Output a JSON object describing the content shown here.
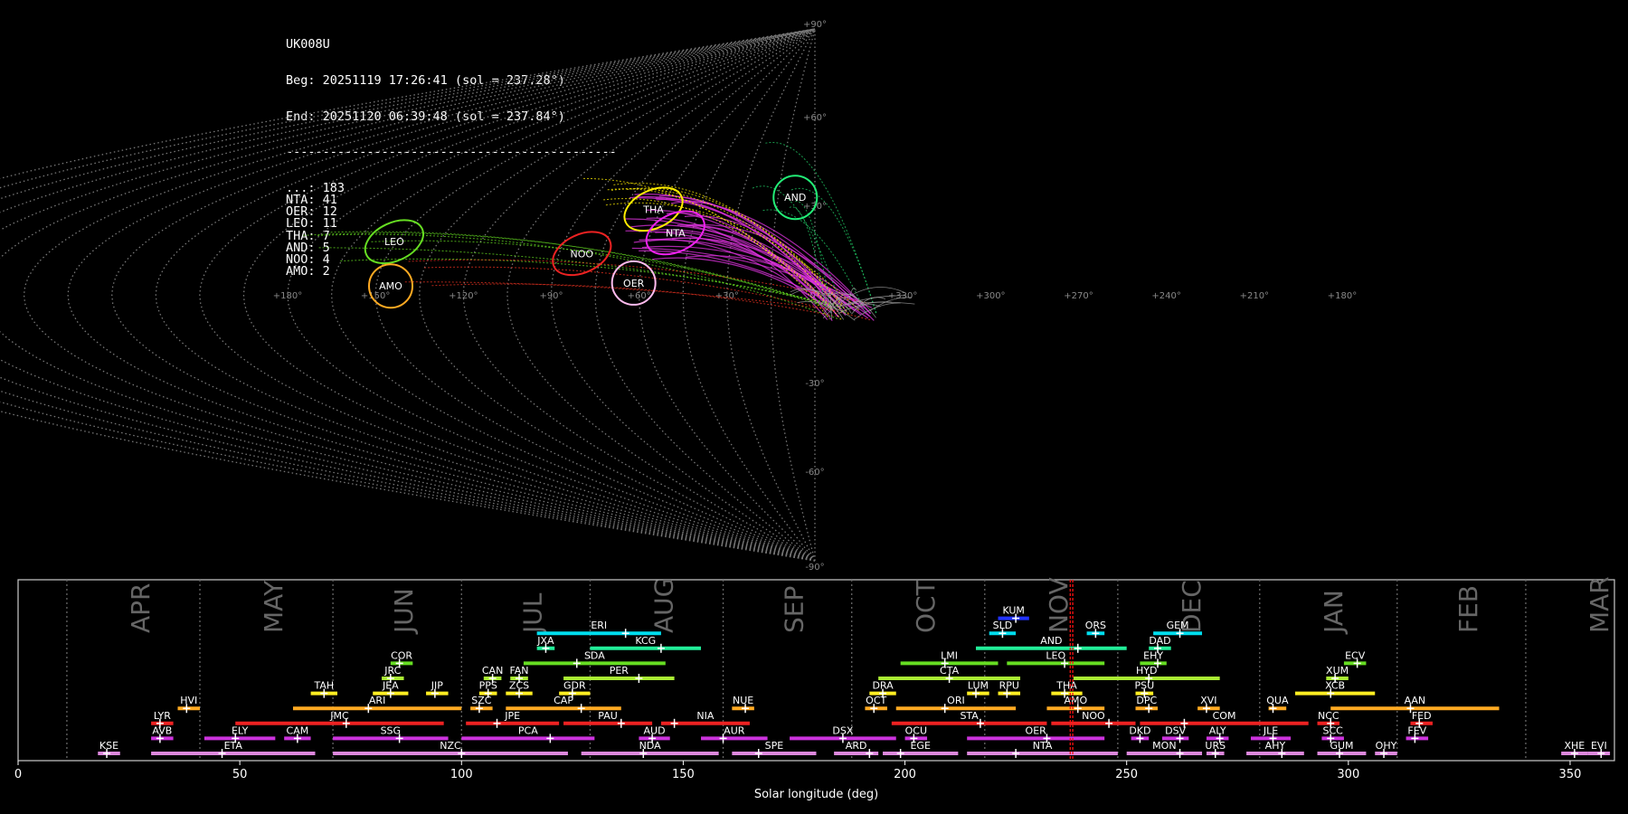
{
  "header": {
    "station": "UK008U",
    "begin": "Beg: 20251119 17:26:41 (sol = 237.28°)",
    "end": "End: 20251120 06:39:48 (sol = 237.84°)",
    "separator": "---------------------------------------------",
    "counts": [
      {
        "code": "...",
        "n": 183
      },
      {
        "code": "NTA",
        "n": 41
      },
      {
        "code": "OER",
        "n": 12
      },
      {
        "code": "LEO",
        "n": 11
      },
      {
        "code": "THA",
        "n": 7
      },
      {
        "code": "AND",
        "n": 5
      },
      {
        "code": "NOO",
        "n": 4
      },
      {
        "code": "AMO",
        "n": 2
      }
    ]
  },
  "chart_data": [
    {
      "type": "scatter",
      "projection": "sinusoidal",
      "lon_labels": [
        "+180°",
        "+150°",
        "+120°",
        "+90°",
        "+60°",
        "+30°",
        "0°",
        "+330°",
        "+300°",
        "+270°",
        "+240°",
        "+210°",
        "+180°"
      ],
      "lat_labels": [
        "+90°",
        "+60°",
        "+30°",
        "0°",
        "-30°",
        "-60°",
        "-90°"
      ],
      "radiants": [
        {
          "name": "AND",
          "lon": 8,
          "lat": 33,
          "color": "#22ee77",
          "shape": "circle"
        },
        {
          "name": "THA",
          "lon": 63,
          "lat": 29,
          "color": "#ffee00",
          "shape": "ellipse"
        },
        {
          "name": "NTA",
          "lon": 51,
          "lat": 21,
          "color": "#ee22ee",
          "shape": "ellipse"
        },
        {
          "name": "LEO",
          "lon": 151,
          "lat": 18,
          "color": "#66dd22",
          "shape": "ellipse"
        },
        {
          "name": "NOO",
          "lon": 82,
          "lat": 14,
          "color": "#ee2222",
          "shape": "ellipse"
        },
        {
          "name": "AMO",
          "lon": 145,
          "lat": 3,
          "color": "#ffaa22",
          "shape": "circle"
        },
        {
          "name": "OER",
          "lon": 62,
          "lat": 4,
          "color": "#ffbbee",
          "shape": "circle"
        }
      ]
    },
    {
      "type": "bar",
      "xlabel": "Solar longitude (deg)",
      "xlim": [
        0,
        360
      ],
      "xticks": [
        0,
        50,
        100,
        150,
        200,
        250,
        300,
        350
      ],
      "current_sol": [
        237.28,
        237.84
      ],
      "months": [
        {
          "name": "APR",
          "start": 11
        },
        {
          "name": "MAY",
          "start": 41
        },
        {
          "name": "JUN",
          "start": 71
        },
        {
          "name": "JUL",
          "start": 100
        },
        {
          "name": "AUG",
          "start": 129
        },
        {
          "name": "SEP",
          "start": 159
        },
        {
          "name": "OCT",
          "start": 188
        },
        {
          "name": "NOV",
          "start": 218
        },
        {
          "name": "DEC",
          "start": 248
        },
        {
          "name": "JAN",
          "start": 280
        },
        {
          "name": "FEB",
          "start": 311
        },
        {
          "name": "MAR",
          "start": 340
        }
      ],
      "showers": [
        {
          "name": "KUM",
          "start": 221,
          "end": 228,
          "peak": 225,
          "row": 10,
          "color": "#2233ff"
        },
        {
          "name": "ERI",
          "start": 117,
          "end": 145,
          "peak": 137,
          "row": 9,
          "color": "#00ddee"
        },
        {
          "name": "SLD",
          "start": 219,
          "end": 225,
          "peak": 222,
          "row": 9,
          "color": "#00ddee"
        },
        {
          "name": "ORS",
          "start": 241,
          "end": 245,
          "peak": 243,
          "row": 9,
          "color": "#00ddee"
        },
        {
          "name": "GEM",
          "start": 256,
          "end": 267,
          "peak": 262,
          "row": 9,
          "color": "#00ddee"
        },
        {
          "name": "JXA",
          "start": 117,
          "end": 121,
          "peak": 119,
          "row": 8,
          "color": "#22ee99"
        },
        {
          "name": "KCG",
          "start": 129,
          "end": 154,
          "peak": 145,
          "row": 8,
          "color": "#22ee99"
        },
        {
          "name": "AND",
          "start": 216,
          "end": 250,
          "peak": 239,
          "row": 8,
          "color": "#22ee99"
        },
        {
          "name": "DAD",
          "start": 255,
          "end": 260,
          "peak": 257,
          "row": 8,
          "color": "#22ee99"
        },
        {
          "name": "COR",
          "start": 84,
          "end": 89,
          "peak": 86,
          "row": 7,
          "color": "#66dd22"
        },
        {
          "name": "SDA",
          "start": 114,
          "end": 146,
          "peak": 126,
          "row": 7,
          "color": "#66dd22"
        },
        {
          "name": "LMI",
          "start": 199,
          "end": 221,
          "peak": 209,
          "row": 7,
          "color": "#66dd22"
        },
        {
          "name": "LEO",
          "start": 223,
          "end": 245,
          "peak": 236,
          "row": 7,
          "color": "#66dd22"
        },
        {
          "name": "EHY",
          "start": 253,
          "end": 259,
          "peak": 257,
          "row": 7,
          "color": "#66dd22"
        },
        {
          "name": "ECV",
          "start": 299,
          "end": 304,
          "peak": 302,
          "row": 7,
          "color": "#66dd22"
        },
        {
          "name": "JRC",
          "start": 82,
          "end": 87,
          "peak": 84,
          "row": 6,
          "color": "#aaee33"
        },
        {
          "name": "CAN",
          "start": 105,
          "end": 109,
          "peak": 107,
          "row": 6,
          "color": "#aaee33"
        },
        {
          "name": "FAN",
          "start": 111,
          "end": 115,
          "peak": 113,
          "row": 6,
          "color": "#aaee33"
        },
        {
          "name": "PER",
          "start": 123,
          "end": 148,
          "peak": 140,
          "row": 6,
          "color": "#aaee33"
        },
        {
          "name": "CTA",
          "start": 194,
          "end": 226,
          "peak": 210,
          "row": 6,
          "color": "#aaee33"
        },
        {
          "name": "HYD",
          "start": 238,
          "end": 271,
          "peak": 255,
          "row": 6,
          "color": "#aaee33"
        },
        {
          "name": "XUM",
          "start": 295,
          "end": 300,
          "peak": 297,
          "row": 6,
          "color": "#aaee33"
        },
        {
          "name": "TAH",
          "start": 66,
          "end": 72,
          "peak": 69,
          "row": 5,
          "color": "#ffee22"
        },
        {
          "name": "JEA",
          "start": 80,
          "end": 88,
          "peak": 84,
          "row": 5,
          "color": "#ffee22"
        },
        {
          "name": "JIP",
          "start": 92,
          "end": 97,
          "peak": 94,
          "row": 5,
          "color": "#ffee22"
        },
        {
          "name": "PPS",
          "start": 104,
          "end": 108,
          "peak": 106,
          "row": 5,
          "color": "#ffee22"
        },
        {
          "name": "ZCS",
          "start": 110,
          "end": 116,
          "peak": 113,
          "row": 5,
          "color": "#ffee22"
        },
        {
          "name": "GDR",
          "start": 122,
          "end": 129,
          "peak": 125,
          "row": 5,
          "color": "#ffee22"
        },
        {
          "name": "DRA",
          "start": 192,
          "end": 198,
          "peak": 195,
          "row": 5,
          "color": "#ffee22"
        },
        {
          "name": "LUM",
          "start": 214,
          "end": 219,
          "peak": 216,
          "row": 5,
          "color": "#ffee22"
        },
        {
          "name": "RPU",
          "start": 221,
          "end": 226,
          "peak": 223,
          "row": 5,
          "color": "#ffee22"
        },
        {
          "name": "THA",
          "start": 233,
          "end": 240,
          "peak": 236,
          "row": 5,
          "color": "#ffee22"
        },
        {
          "name": "PSU",
          "start": 252,
          "end": 256,
          "peak": 254,
          "row": 5,
          "color": "#ffee22"
        },
        {
          "name": "XCB",
          "start": 288,
          "end": 306,
          "peak": 296,
          "row": 5,
          "color": "#ffee22"
        },
        {
          "name": "HVI",
          "start": 36,
          "end": 41,
          "peak": 38,
          "row": 4,
          "color": "#ffaa22"
        },
        {
          "name": "ARI",
          "start": 62,
          "end": 100,
          "peak": 79,
          "row": 4,
          "color": "#ffaa22"
        },
        {
          "name": "SZC",
          "start": 102,
          "end": 107,
          "peak": 104,
          "row": 4,
          "color": "#ffaa22"
        },
        {
          "name": "CAP",
          "start": 110,
          "end": 136,
          "peak": 127,
          "row": 4,
          "color": "#ffaa22"
        },
        {
          "name": "NUE",
          "start": 161,
          "end": 166,
          "peak": 164,
          "row": 4,
          "color": "#ffaa22"
        },
        {
          "name": "OCT",
          "start": 191,
          "end": 196,
          "peak": 193,
          "row": 4,
          "color": "#ffaa22"
        },
        {
          "name": "ORI",
          "start": 198,
          "end": 225,
          "peak": 209,
          "row": 4,
          "color": "#ffaa22"
        },
        {
          "name": "AMO",
          "start": 232,
          "end": 245,
          "peak": 239,
          "row": 4,
          "color": "#ffaa22"
        },
        {
          "name": "DPC",
          "start": 252,
          "end": 257,
          "peak": 255,
          "row": 4,
          "color": "#ffaa22"
        },
        {
          "name": "XVI",
          "start": 266,
          "end": 271,
          "peak": 268,
          "row": 4,
          "color": "#ffaa22"
        },
        {
          "name": "QUA",
          "start": 282,
          "end": 286,
          "peak": 283,
          "row": 4,
          "color": "#ffaa22"
        },
        {
          "name": "AAN",
          "start": 296,
          "end": 334,
          "peak": 314,
          "row": 4,
          "color": "#ffaa22"
        },
        {
          "name": "LYR",
          "start": 30,
          "end": 35,
          "peak": 32,
          "row": 3,
          "color": "#ee2222"
        },
        {
          "name": "JMC",
          "start": 49,
          "end": 96,
          "peak": 74,
          "row": 3,
          "color": "#ee2222"
        },
        {
          "name": "JPE",
          "start": 101,
          "end": 122,
          "peak": 108,
          "row": 3,
          "color": "#ee2222"
        },
        {
          "name": "PAU",
          "start": 123,
          "end": 143,
          "peak": 136,
          "row": 3,
          "color": "#ee2222"
        },
        {
          "name": "NIA",
          "start": 145,
          "end": 165,
          "peak": 148,
          "row": 3,
          "color": "#ee2222"
        },
        {
          "name": "STA",
          "start": 197,
          "end": 232,
          "peak": 217,
          "row": 3,
          "color": "#ee2222"
        },
        {
          "name": "NOO",
          "start": 233,
          "end": 252,
          "peak": 246,
          "row": 3,
          "color": "#ee2222"
        },
        {
          "name": "COM",
          "start": 253,
          "end": 291,
          "peak": 263,
          "row": 3,
          "color": "#ee2222"
        },
        {
          "name": "NCC",
          "start": 293,
          "end": 298,
          "peak": 296,
          "row": 3,
          "color": "#ee2222"
        },
        {
          "name": "FED",
          "start": 314,
          "end": 319,
          "peak": 316,
          "row": 3,
          "color": "#ee2222"
        },
        {
          "name": "AVB",
          "start": 30,
          "end": 35,
          "peak": 32,
          "row": 2,
          "color": "#cc33dd"
        },
        {
          "name": "ELY",
          "start": 42,
          "end": 58,
          "peak": 49,
          "row": 2,
          "color": "#cc33dd"
        },
        {
          "name": "CAM",
          "start": 60,
          "end": 66,
          "peak": 63,
          "row": 2,
          "color": "#cc33dd"
        },
        {
          "name": "SSG",
          "start": 71,
          "end": 97,
          "peak": 86,
          "row": 2,
          "color": "#cc33dd"
        },
        {
          "name": "PCA",
          "start": 100,
          "end": 130,
          "peak": 120,
          "row": 2,
          "color": "#cc33dd"
        },
        {
          "name": "AUD",
          "start": 140,
          "end": 147,
          "peak": 143,
          "row": 2,
          "color": "#cc33dd"
        },
        {
          "name": "AUR",
          "start": 154,
          "end": 169,
          "peak": 159,
          "row": 2,
          "color": "#cc33dd"
        },
        {
          "name": "DSX",
          "start": 174,
          "end": 198,
          "peak": 186,
          "row": 2,
          "color": "#cc33dd"
        },
        {
          "name": "OCU",
          "start": 200,
          "end": 205,
          "peak": 202,
          "row": 2,
          "color": "#cc33dd"
        },
        {
          "name": "OER",
          "start": 214,
          "end": 245,
          "peak": 232,
          "row": 2,
          "color": "#cc33dd"
        },
        {
          "name": "DKD",
          "start": 251,
          "end": 255,
          "peak": 253,
          "row": 2,
          "color": "#cc33dd"
        },
        {
          "name": "DSV",
          "start": 258,
          "end": 264,
          "peak": 262,
          "row": 2,
          "color": "#cc33dd"
        },
        {
          "name": "ALY",
          "start": 268,
          "end": 273,
          "peak": 271,
          "row": 2,
          "color": "#cc33dd"
        },
        {
          "name": "JLE",
          "start": 278,
          "end": 287,
          "peak": 283,
          "row": 2,
          "color": "#cc33dd"
        },
        {
          "name": "SCC",
          "start": 294,
          "end": 299,
          "peak": 296,
          "row": 2,
          "color": "#cc33dd"
        },
        {
          "name": "FEV",
          "start": 313,
          "end": 318,
          "peak": 315,
          "row": 2,
          "color": "#cc33dd"
        },
        {
          "name": "KSE",
          "start": 18,
          "end": 23,
          "peak": 20,
          "row": 1,
          "color": "#dd88dd"
        },
        {
          "name": "ETA",
          "start": 30,
          "end": 67,
          "peak": 46,
          "row": 1,
          "color": "#dd88dd"
        },
        {
          "name": "NZC",
          "start": 71,
          "end": 124,
          "peak": 100,
          "row": 1,
          "color": "#dd88dd"
        },
        {
          "name": "NDA",
          "start": 127,
          "end": 158,
          "peak": 141,
          "row": 1,
          "color": "#dd88dd"
        },
        {
          "name": "SPE",
          "start": 161,
          "end": 180,
          "peak": 167,
          "row": 1,
          "color": "#dd88dd"
        },
        {
          "name": "ARD",
          "start": 184,
          "end": 194,
          "peak": 192,
          "row": 1,
          "color": "#dd88dd"
        },
        {
          "name": "EGE",
          "start": 195,
          "end": 212,
          "peak": 199,
          "row": 1,
          "color": "#dd88dd"
        },
        {
          "name": "NTA",
          "start": 214,
          "end": 248,
          "peak": 225,
          "row": 1,
          "color": "#dd88dd"
        },
        {
          "name": "MON",
          "start": 250,
          "end": 267,
          "peak": 262,
          "row": 1,
          "color": "#dd88dd"
        },
        {
          "name": "URS",
          "start": 268,
          "end": 272,
          "peak": 270,
          "row": 1,
          "color": "#dd88dd"
        },
        {
          "name": "AHY",
          "start": 277,
          "end": 290,
          "peak": 285,
          "row": 1,
          "color": "#dd88dd"
        },
        {
          "name": "GUM",
          "start": 293,
          "end": 304,
          "peak": 298,
          "row": 1,
          "color": "#dd88dd"
        },
        {
          "name": "OHY",
          "start": 306,
          "end": 311,
          "peak": 308,
          "row": 1,
          "color": "#dd88dd"
        },
        {
          "name": "XHE",
          "start": 348,
          "end": 354,
          "peak": 351,
          "row": 1,
          "color": "#dd88dd"
        },
        {
          "name": "EVI",
          "start": 354,
          "end": 359,
          "peak": 357,
          "row": 1,
          "color": "#dd88dd"
        }
      ]
    }
  ]
}
